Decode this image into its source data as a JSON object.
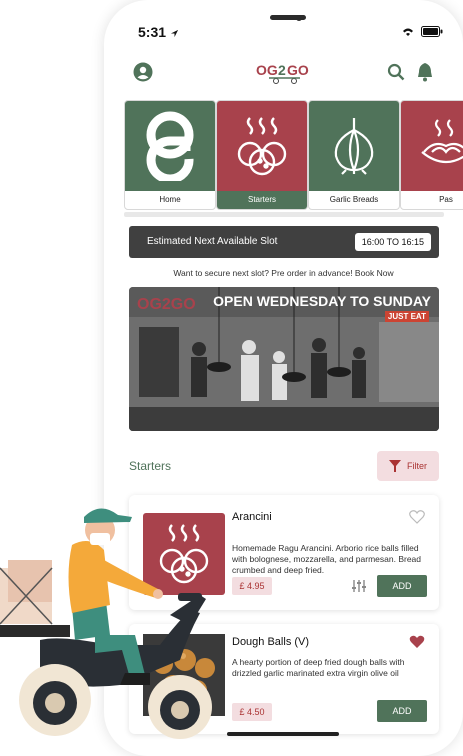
{
  "status": {
    "time": "5:31"
  },
  "header": {
    "logo_text": "OG2GO"
  },
  "categories": [
    {
      "label": "Home",
      "icon": "og-logo-icon",
      "color": "#50735a"
    },
    {
      "label": "Starters",
      "icon": "steaming-balls-icon",
      "color": "#a8424c"
    },
    {
      "label": "Garlic Breads",
      "icon": "garlic-icon",
      "color": "#50735a"
    },
    {
      "label": "Pas",
      "icon": "pasta-icon",
      "color": "#a8424c"
    }
  ],
  "slot": {
    "label": "Estimated Next Available Slot",
    "time": "16:00 TO 16:15"
  },
  "preorder_text": "Want to secure next slot? Pre order in advance! Book Now",
  "banner": {
    "logo_text": "OG2GO",
    "title": "OPEN WEDNESDAY TO SUNDAY",
    "subtitle": "JUST EAT"
  },
  "section": {
    "title": "Starters",
    "filter_label": "Filter"
  },
  "items": [
    {
      "name": "Arancini",
      "desc": "Homemade Ragu Arancini.  Arborio rice balls filled with bolognese, mozzarella, and parmesan.  Bread crumbed and deep fried.",
      "price": "£ 4.95",
      "add_label": "ADD",
      "favorite": false
    },
    {
      "name": "Dough Balls (V)",
      "desc": "A hearty portion of deep fried dough balls with drizzled garlic marinated extra virgin olive oil",
      "price": "£ 4.50",
      "add_label": "ADD",
      "favorite": true
    }
  ],
  "colors": {
    "green": "#50735a",
    "red": "#a8424c",
    "dark": "#404040",
    "pink": "#f3dde0"
  }
}
